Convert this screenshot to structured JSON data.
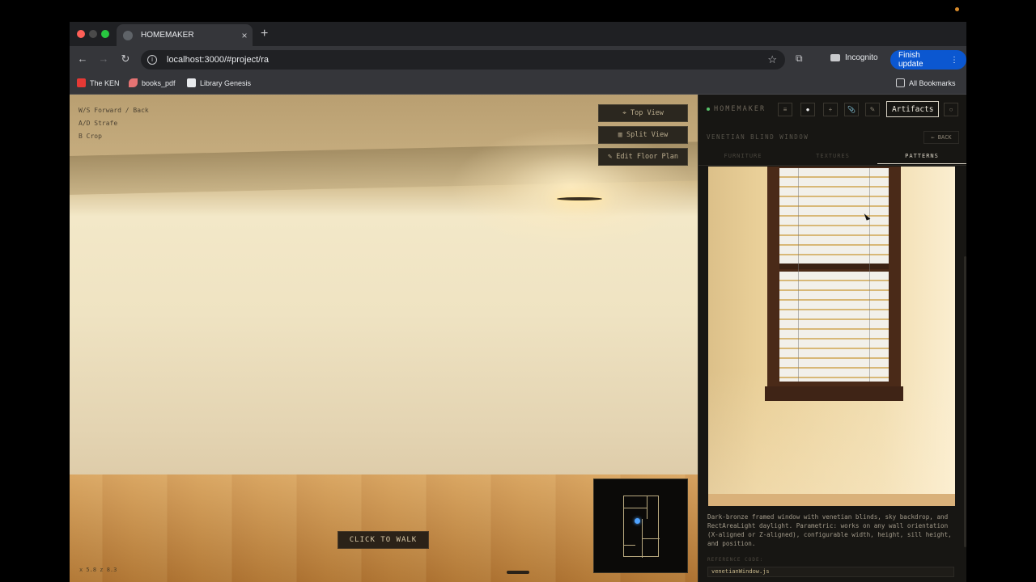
{
  "browser": {
    "tab_title": "HOMEMAKER",
    "tab_close": "×",
    "new_tab": "+",
    "url": "localhost:3000/#project/ra",
    "back": "←",
    "forward": "→",
    "reload": "↻",
    "star": "☆",
    "incognito_label": "Incognito",
    "finish_update_label": "Finish update",
    "finish_update_menu": "⋮",
    "bookmarks": [
      {
        "label": "The KEN",
        "color": "#e53935"
      },
      {
        "label": "books_pdf",
        "color": "#e57373"
      },
      {
        "label": "Library Genesis",
        "color": "#e8eaed"
      }
    ],
    "all_bookmarks_label": "All Bookmarks"
  },
  "viewport": {
    "controls": [
      "W/S Forward / Back",
      "A/D Strafe",
      "B Crop"
    ],
    "top_view_label": "⌖ Top View",
    "split_view_label": "▥ Split View",
    "edit_floor_plan_label": "✎ Edit Floor Plan",
    "click_to_walk_label": "CLICK TO WALK",
    "coords": "x 5.8 z 8.3"
  },
  "panel": {
    "brand": "HOMEMAKER",
    "icons": [
      "≡",
      "●",
      "+",
      "📎",
      "✎"
    ],
    "artifacts_label": "Artifacts",
    "settings_icon": "○",
    "title": "VENETIAN BLIND WINDOW",
    "back_label": "← BACK",
    "tabs": [
      {
        "label": "FURNITURE",
        "active": false
      },
      {
        "label": "TEXTURES",
        "active": false
      },
      {
        "label": "PATTERNS",
        "active": true
      }
    ],
    "description": "Dark-bronze framed window with venetian blinds, sky backdrop, and RectAreaLight daylight. Parametric: works on any wall orientation (X-aligned or Z-aligned), configurable width, height, sill height, and position.",
    "reference_label": "REFERENCE CODE:",
    "reference_code": "venetianWindow.js"
  }
}
